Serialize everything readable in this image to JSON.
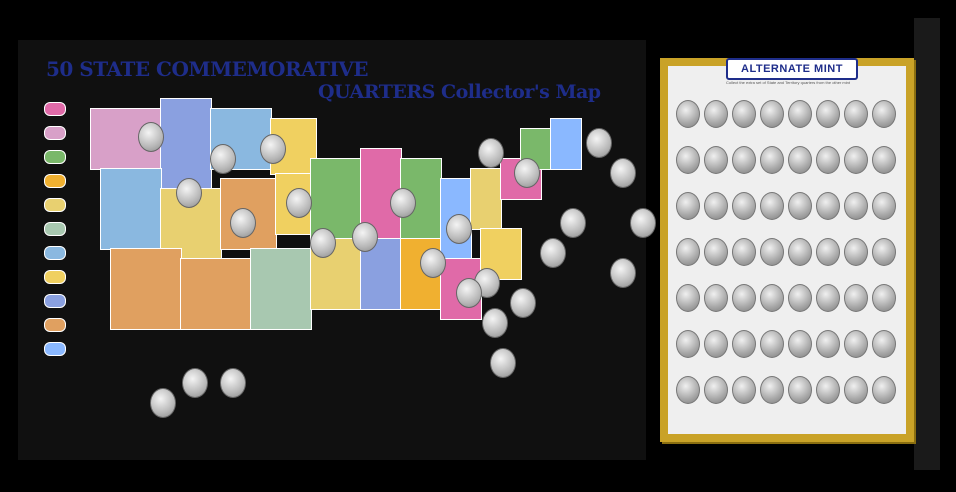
{
  "titles": {
    "line1": "50 STATE COMMEMORATIVE",
    "line2": "QUARTERS Collector's Map"
  },
  "album": {
    "title": "ALTERNATE MINT",
    "subtitle": "Collect the extra set of State and Territory quarters from the other mint"
  },
  "colors": {
    "title": "#1e2d8a",
    "album_frame": "#c9a227",
    "legend": [
      "#e06aa8",
      "#d8a0c8",
      "#7ab86a",
      "#f0b030",
      "#e8d070",
      "#a8c8b0",
      "#8ab8e0",
      "#f0d060",
      "#8aa0e0",
      "#e0a060",
      "#8ab8ff"
    ]
  }
}
